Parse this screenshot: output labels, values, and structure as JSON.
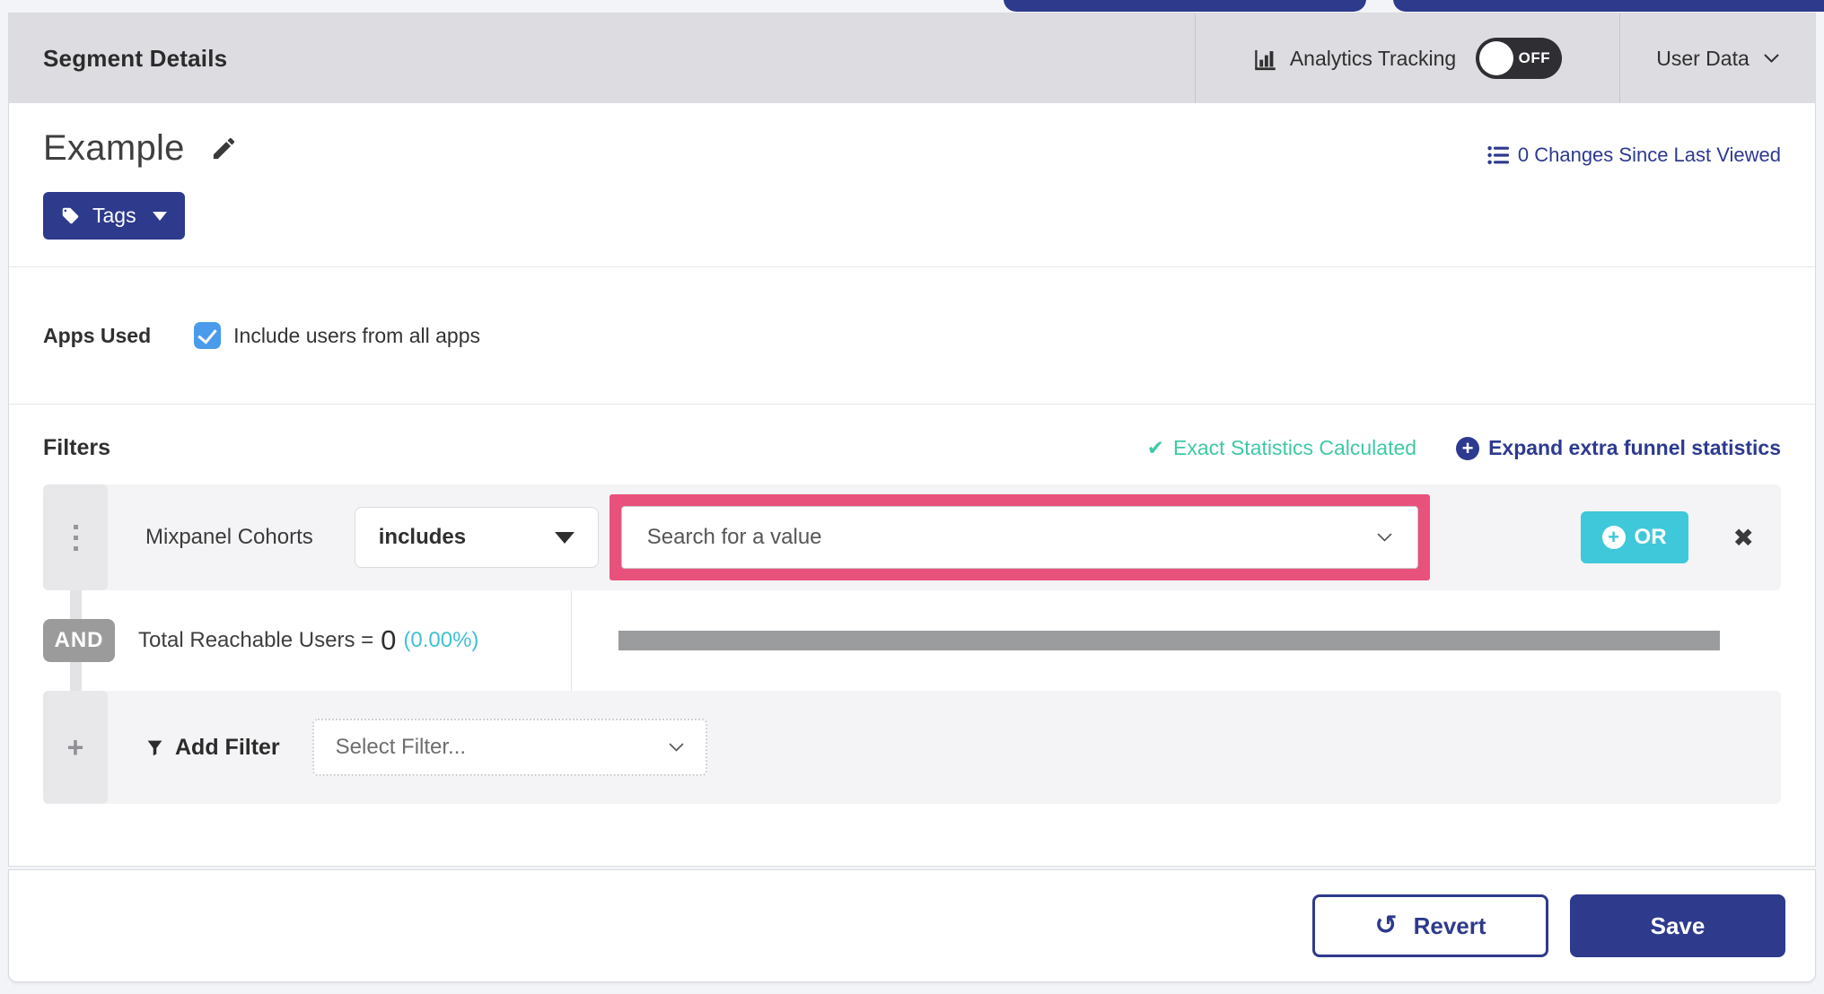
{
  "header": {
    "title": "Segment Details",
    "analytics_tracking_label": "Analytics Tracking",
    "toggle_state": "OFF",
    "user_data_label": "User Data"
  },
  "segment": {
    "name": "Example",
    "tags_label": "Tags",
    "changes_link": "0 Changes Since Last Viewed"
  },
  "apps_used": {
    "label": "Apps Used",
    "checkbox_label": "Include users from all apps",
    "checked": true
  },
  "filters": {
    "heading": "Filters",
    "exact_stats_label": "Exact Statistics Calculated",
    "expand_link_label": "Expand extra funnel statistics",
    "filter_row": {
      "attribute": "Mixpanel Cohorts",
      "operator": "includes",
      "value_placeholder": "Search for a value",
      "or_label": "OR"
    },
    "and_label": "AND",
    "total_label": "Total Reachable Users =",
    "total_value": "0",
    "total_percent": "(0.00%)",
    "add_filter_label": "Add Filter",
    "select_filter_placeholder": "Select Filter..."
  },
  "footer": {
    "revert_label": "Revert",
    "save_label": "Save"
  },
  "icons": {
    "check": "✔",
    "close": "✖",
    "revert": "↺",
    "plus": "+"
  },
  "colors": {
    "navy": "#2e3a8c",
    "teal_or": "#3fc8da",
    "green_stats": "#3ec9a6",
    "cyan_percent": "#3fc2d4",
    "pink_highlight": "#e8517b",
    "checkbox_blue": "#4a9bec",
    "and_gray": "#9b9b9b",
    "progress_gray": "#9a9c9e"
  }
}
